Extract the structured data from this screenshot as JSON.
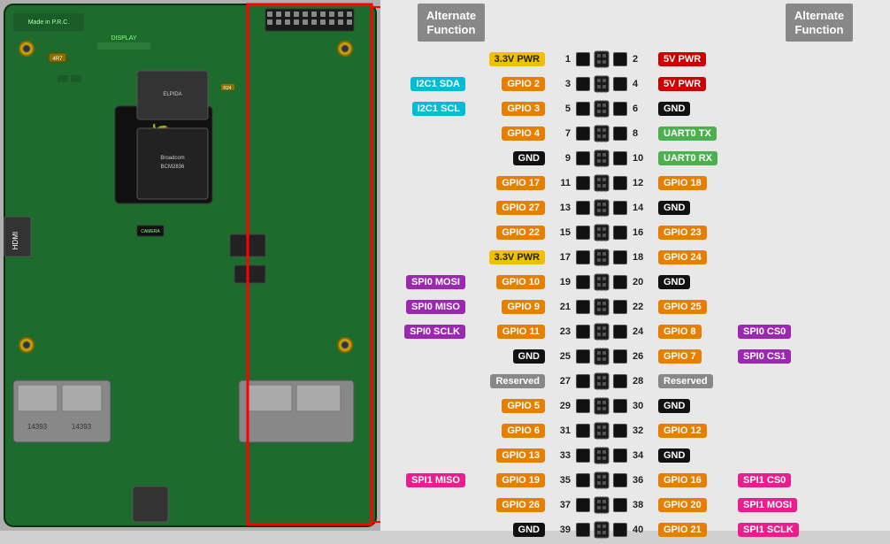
{
  "header": {
    "left_alt_func": "Alternate\nFunction",
    "right_alt_func": "Alternate\nFunction"
  },
  "pins": [
    {
      "left_pin": 1,
      "left_label": "3.3V PWR",
      "left_color": "chip-yellow",
      "left_alt": "",
      "left_alt_color": "",
      "right_pin": 2,
      "right_label": "5V PWR",
      "right_color": "chip-red",
      "right_alt": "",
      "right_alt_color": ""
    },
    {
      "left_pin": 3,
      "left_label": "GPIO 2",
      "left_color": "chip-orange",
      "left_alt": "I2C1 SDA",
      "left_alt_color": "chip-cyan",
      "right_pin": 4,
      "right_label": "5V PWR",
      "right_color": "chip-red",
      "right_alt": "",
      "right_alt_color": ""
    },
    {
      "left_pin": 5,
      "left_label": "GPIO 3",
      "left_color": "chip-orange",
      "left_alt": "I2C1 SCL",
      "left_alt_color": "chip-cyan",
      "right_pin": 6,
      "right_label": "GND",
      "right_color": "chip-black",
      "right_alt": "",
      "right_alt_color": ""
    },
    {
      "left_pin": 7,
      "left_label": "GPIO 4",
      "left_color": "chip-orange",
      "left_alt": "",
      "left_alt_color": "",
      "right_pin": 8,
      "right_label": "UART0 TX",
      "right_color": "chip-green",
      "right_alt": "",
      "right_alt_color": ""
    },
    {
      "left_pin": 9,
      "left_label": "GND",
      "left_color": "chip-black",
      "left_alt": "",
      "left_alt_color": "",
      "right_pin": 10,
      "right_label": "UART0 RX",
      "right_color": "chip-green",
      "right_alt": "",
      "right_alt_color": ""
    },
    {
      "left_pin": 11,
      "left_label": "GPIO 17",
      "left_color": "chip-orange",
      "left_alt": "",
      "left_alt_color": "",
      "right_pin": 12,
      "right_label": "GPIO 18",
      "right_color": "chip-orange",
      "right_alt": "",
      "right_alt_color": ""
    },
    {
      "left_pin": 13,
      "left_label": "GPIO 27",
      "left_color": "chip-orange",
      "left_alt": "",
      "left_alt_color": "",
      "right_pin": 14,
      "right_label": "GND",
      "right_color": "chip-black",
      "right_alt": "",
      "right_alt_color": ""
    },
    {
      "left_pin": 15,
      "left_label": "GPIO 22",
      "left_color": "chip-orange",
      "left_alt": "",
      "left_alt_color": "",
      "right_pin": 16,
      "right_label": "GPIO 23",
      "right_color": "chip-orange",
      "right_alt": "",
      "right_alt_color": ""
    },
    {
      "left_pin": 17,
      "left_label": "3.3V PWR",
      "left_color": "chip-yellow",
      "left_alt": "",
      "left_alt_color": "",
      "right_pin": 18,
      "right_label": "GPIO 24",
      "right_color": "chip-orange",
      "right_alt": "",
      "right_alt_color": ""
    },
    {
      "left_pin": 19,
      "left_label": "GPIO 10",
      "left_color": "chip-orange",
      "left_alt": "SPI0 MOSI",
      "left_alt_color": "chip-purple",
      "right_pin": 20,
      "right_label": "GND",
      "right_color": "chip-black",
      "right_alt": "",
      "right_alt_color": ""
    },
    {
      "left_pin": 21,
      "left_label": "GPIO 9",
      "left_color": "chip-orange",
      "left_alt": "SPI0 MISO",
      "left_alt_color": "chip-purple",
      "right_pin": 22,
      "right_label": "GPIO 25",
      "right_color": "chip-orange",
      "right_alt": "",
      "right_alt_color": ""
    },
    {
      "left_pin": 23,
      "left_label": "GPIO 11",
      "left_color": "chip-orange",
      "left_alt": "SPI0 SCLK",
      "left_alt_color": "chip-purple",
      "right_pin": 24,
      "right_label": "GPIO 8",
      "right_color": "chip-orange",
      "right_alt": "SPI0 CS0",
      "right_alt_color": "chip-purple"
    },
    {
      "left_pin": 25,
      "left_label": "GND",
      "left_color": "chip-black",
      "left_alt": "",
      "left_alt_color": "",
      "right_pin": 26,
      "right_label": "GPIO 7",
      "right_color": "chip-orange",
      "right_alt": "SPI0 CS1",
      "right_alt_color": "chip-purple"
    },
    {
      "left_pin": 27,
      "left_label": "Reserved",
      "left_color": "chip-gray",
      "left_alt": "",
      "left_alt_color": "",
      "right_pin": 28,
      "right_label": "Reserved",
      "right_color": "chip-gray",
      "right_alt": "",
      "right_alt_color": ""
    },
    {
      "left_pin": 29,
      "left_label": "GPIO 5",
      "left_color": "chip-orange",
      "left_alt": "",
      "left_alt_color": "",
      "right_pin": 30,
      "right_label": "GND",
      "right_color": "chip-black",
      "right_alt": "",
      "right_alt_color": ""
    },
    {
      "left_pin": 31,
      "left_label": "GPIO 6",
      "left_color": "chip-orange",
      "left_alt": "",
      "left_alt_color": "",
      "right_pin": 32,
      "right_label": "GPIO 12",
      "right_color": "chip-orange",
      "right_alt": "",
      "right_alt_color": ""
    },
    {
      "left_pin": 33,
      "left_label": "GPIO 13",
      "left_color": "chip-orange",
      "left_alt": "",
      "left_alt_color": "",
      "right_pin": 34,
      "right_label": "GND",
      "right_color": "chip-black",
      "right_alt": "",
      "right_alt_color": ""
    },
    {
      "left_pin": 35,
      "left_label": "GPIO 19",
      "left_color": "chip-orange",
      "left_alt": "SPI1 MISO",
      "left_alt_color": "chip-magenta",
      "right_pin": 36,
      "right_label": "GPIO 16",
      "right_color": "chip-orange",
      "right_alt": "SPI1 CS0",
      "right_alt_color": "chip-magenta"
    },
    {
      "left_pin": 37,
      "left_label": "GPIO 26",
      "left_color": "chip-orange",
      "left_alt": "",
      "left_alt_color": "",
      "right_pin": 38,
      "right_label": "GPIO 20",
      "right_color": "chip-orange",
      "right_alt": "SPI1 MOSI",
      "right_alt_color": "chip-magenta"
    },
    {
      "left_pin": 39,
      "left_label": "GND",
      "left_color": "chip-black",
      "left_alt": "",
      "left_alt_color": "",
      "right_pin": 40,
      "right_label": "GPIO 21",
      "right_color": "chip-orange",
      "right_alt": "SPI1 SCLK",
      "right_alt_color": "chip-magenta"
    }
  ]
}
